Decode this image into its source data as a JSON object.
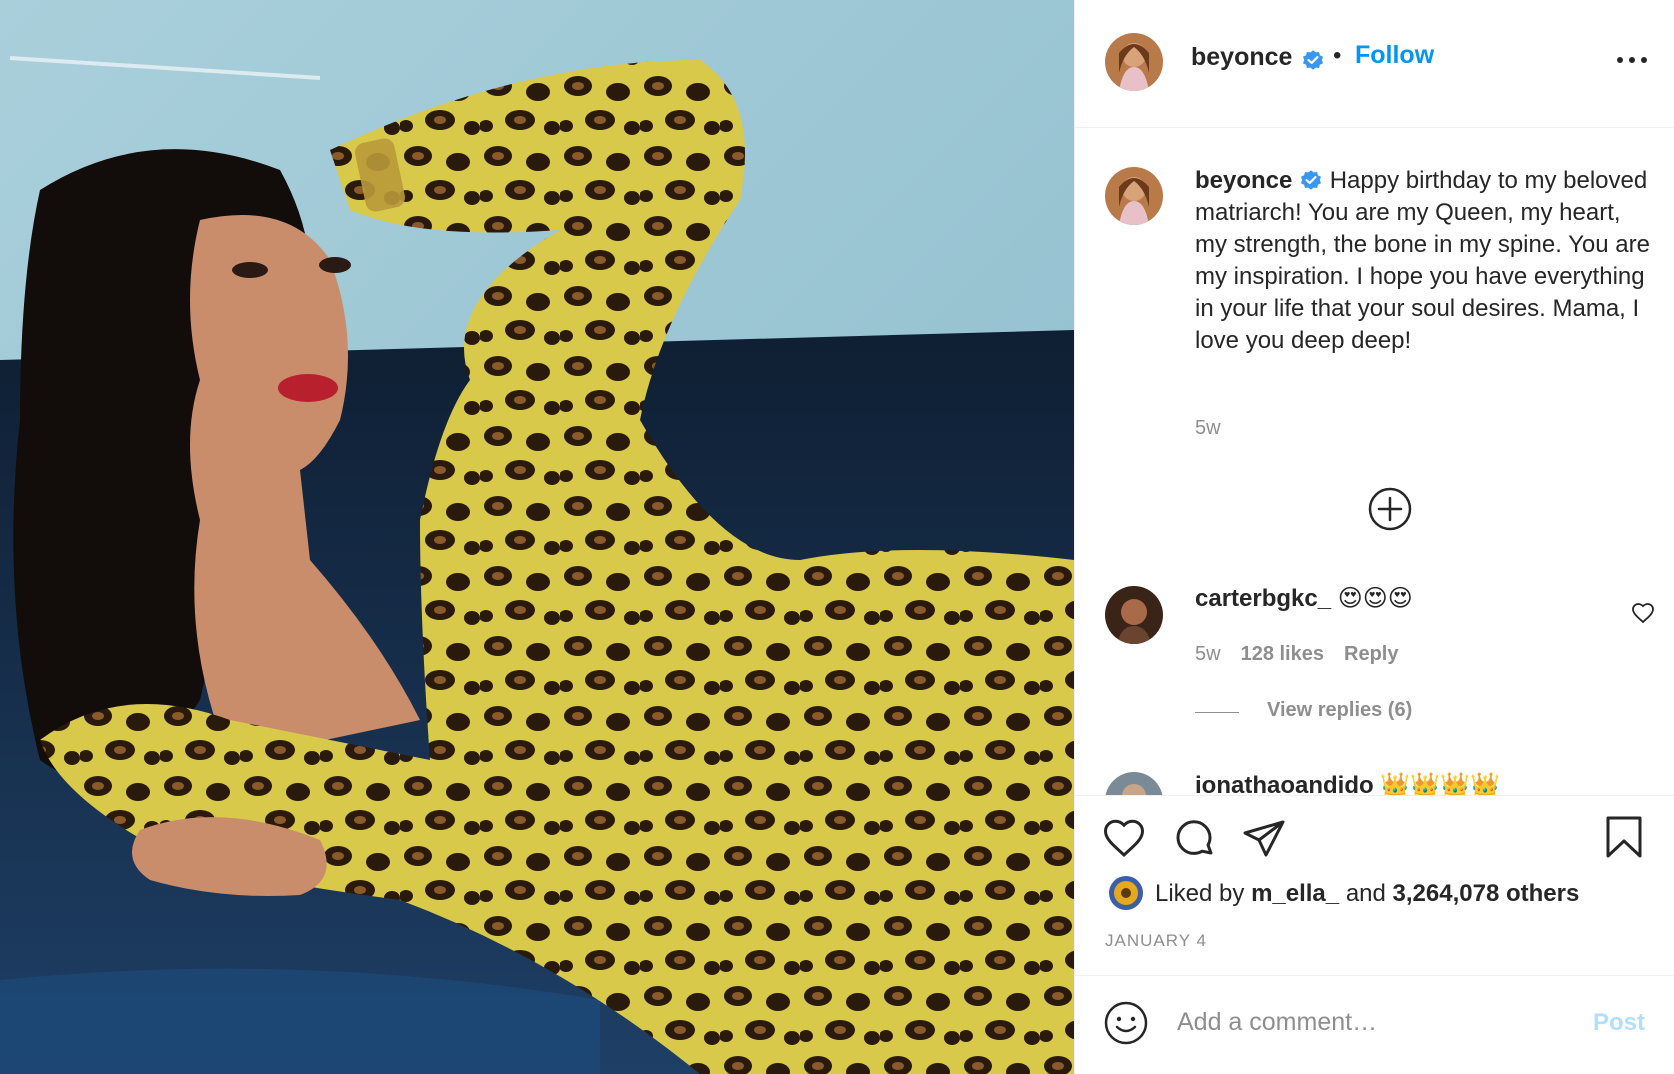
{
  "post": {
    "username": "beyonce",
    "follow_label": "Follow",
    "separator": "•",
    "icons": {
      "verified": "verified-badge-icon",
      "more": "more-options-icon"
    },
    "accent_color": "#0095f6",
    "caption": {
      "username": "beyonce",
      "text": "Happy birthday to my beloved matriarch! You are my Queen, my heart, my strength, the bone in my spine. You are my inspiration. I hope you have everything in your life that your soul desires. Mama, I love you deep deep!",
      "time": "5w"
    },
    "comments": [
      {
        "username": "carterbgkc_",
        "text": "😍😍😍",
        "time": "5w",
        "likes": "128 likes",
        "reply_label": "Reply",
        "view_replies": "View replies (6)"
      },
      {
        "username": "ionathaoandido",
        "text": "👑👑👑👑"
      }
    ],
    "liked_by_prefix": "Liked by",
    "liked_by_user": "m_ella_",
    "liked_by_and": "and",
    "liked_by_others": "3,264,078 others",
    "date": "JANUARY 4",
    "comment_placeholder": "Add a comment…",
    "post_label": "Post"
  }
}
